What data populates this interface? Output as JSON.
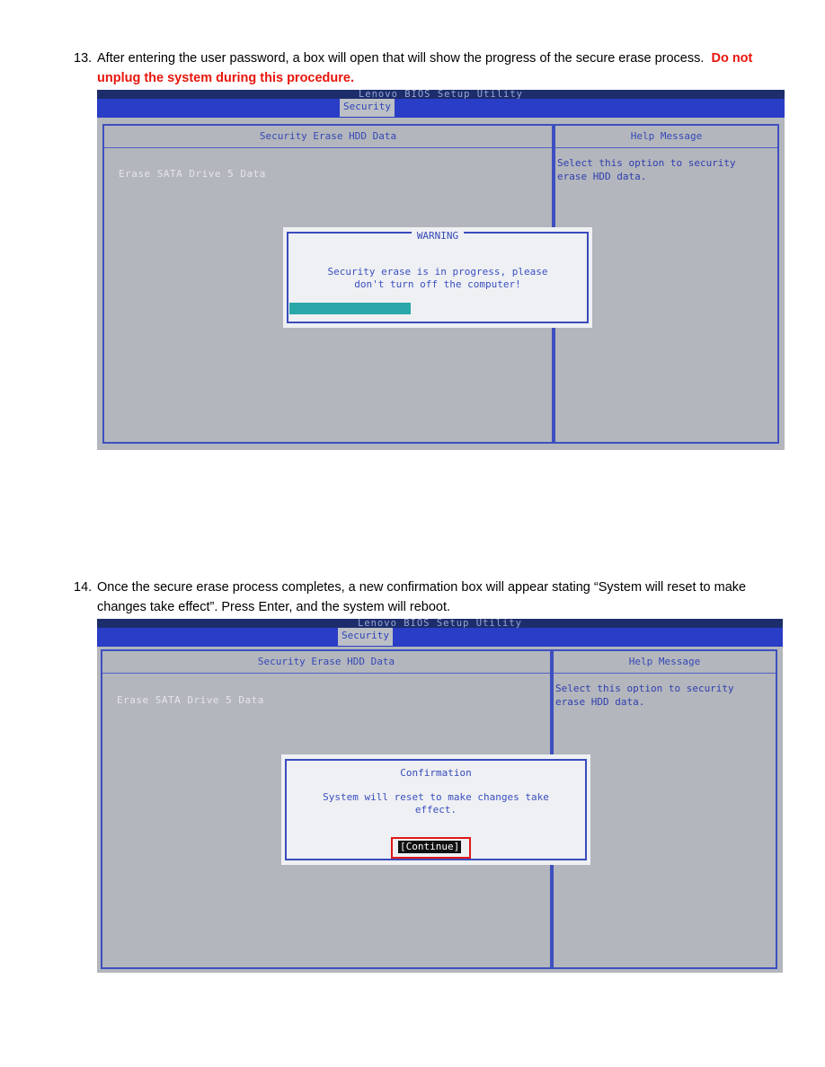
{
  "steps": [
    {
      "number": "13.",
      "text": "After entering the user password, a box will open that will show the progress of the secure erase process.",
      "warning": "Do not unplug the system during this procedure."
    },
    {
      "number": "14.",
      "text": "Once the secure erase process completes, a new confirmation box will appear stating “System will reset to make changes take effect”.  Press Enter, and the system will reboot."
    }
  ],
  "screens": [
    {
      "bios_title": "Lenovo BIOS Setup Utility",
      "tab": "Security",
      "panel_title": "Security Erase HDD Data",
      "item": "Erase SATA Drive 5 Data",
      "help_title": "Help Message",
      "help_text": "Select this option to security\nerase HDD data.",
      "dialog": {
        "title": "WARNING",
        "message": "Security erase is in progress, please\ndon't turn off the computer!",
        "progress": 0.41
      }
    },
    {
      "bios_title": "Lenovo BIOS Setup Utility",
      "tab": "Security",
      "panel_title": "Security Erase HDD Data",
      "item": "Erase SATA Drive 5 Data",
      "help_title": "Help Message",
      "help_text": "Select this option to security\nerase HDD data.",
      "dialog": {
        "title": "Confirmation",
        "message": "System will reset to make changes take\neffect.",
        "button": "[Continue]"
      }
    }
  ],
  "colors": {
    "warning_text": "#e8160c",
    "bios_background": "#b3b6bc",
    "bios_blue": "#2a3dc6",
    "progress_fill": "#2aa7a8",
    "highlight_outline": "#e01818"
  }
}
